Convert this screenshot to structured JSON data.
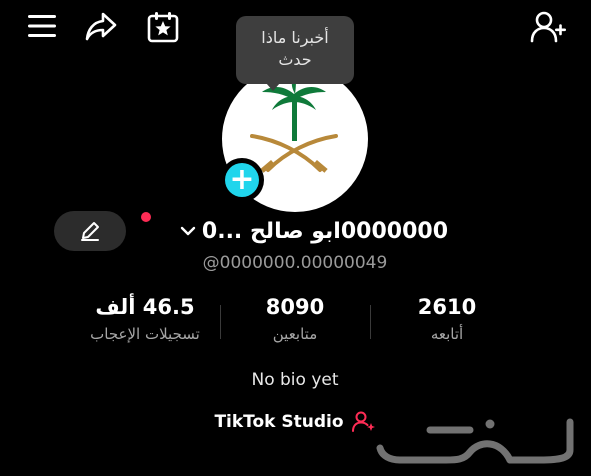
{
  "topbar": {
    "menu_icon": "hamburger-menu-icon",
    "share_icon": "share-arrow-icon",
    "calendar_icon": "calendar-star-icon",
    "add_friend_icon": "add-user-icon"
  },
  "tooltip": {
    "line1": "أخبرنا ماذا",
    "line2": "حدث"
  },
  "profile": {
    "display_name": "0000000ابو صالح  ...0",
    "username": "@0000000.00000049",
    "edit_icon": "pencil-icon",
    "add_avatar_icon": "plus-icon"
  },
  "stats": {
    "following": {
      "value": "2610",
      "label": "أتابعه"
    },
    "followers": {
      "value": "8090",
      "label": "متابعين"
    },
    "likes": {
      "value": "46.5 ألف",
      "label": "تسجيلات الإعجاب"
    }
  },
  "bio": "No bio yet",
  "studio": {
    "label": "TikTok Studio",
    "icon": "person-sparkle-icon"
  },
  "colors": {
    "background": "#000000",
    "accent_cyan": "#20d5ec",
    "notification_red": "#fe2c55",
    "muted_text": "#9a9a9a"
  }
}
